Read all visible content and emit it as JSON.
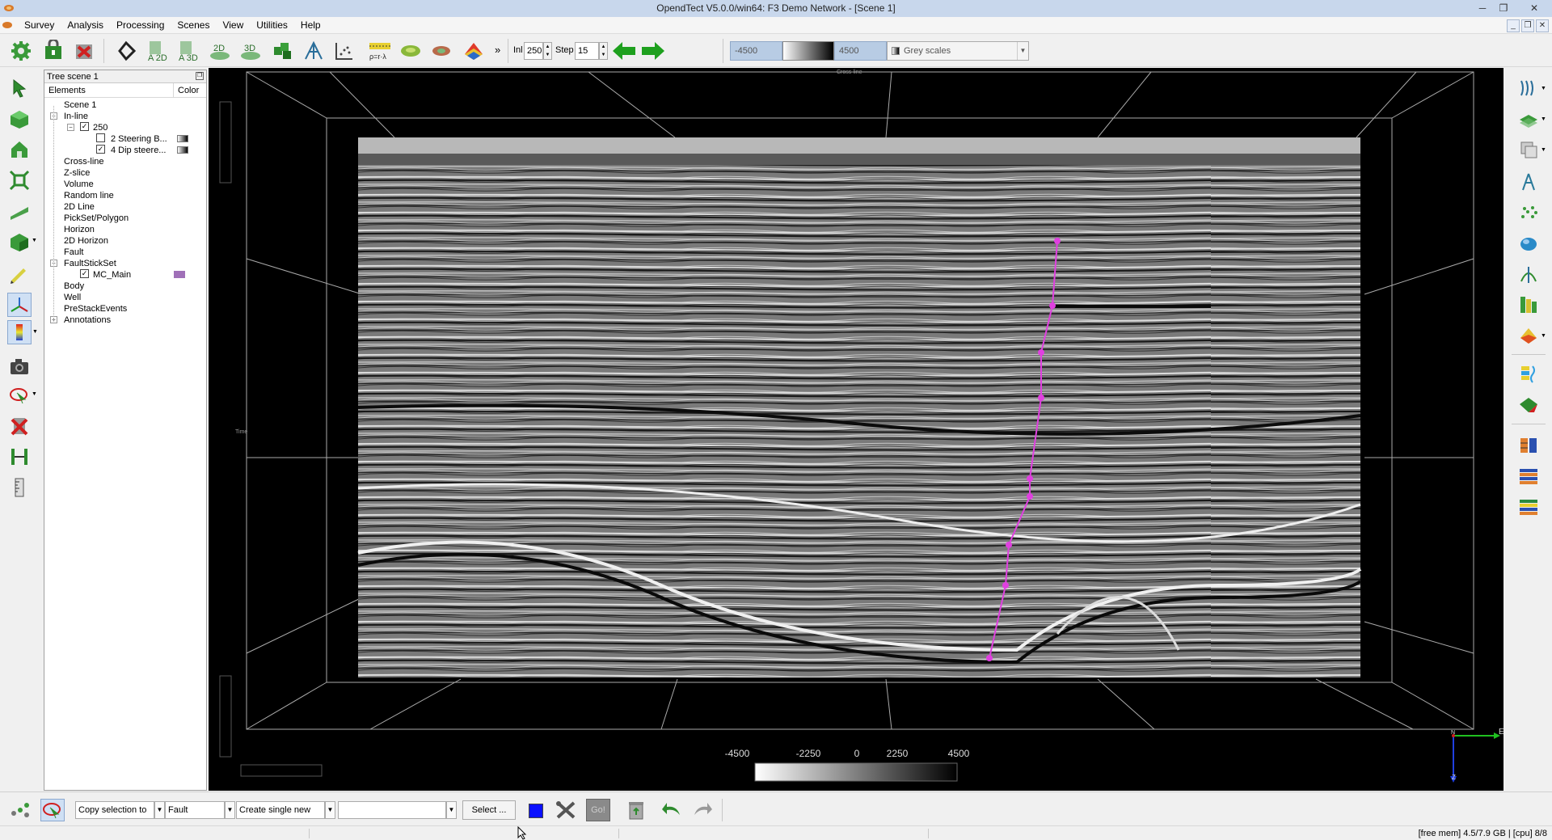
{
  "window": {
    "title": "OpendTect V5.0.0/win64: F3 Demo Network - [Scene 1]",
    "minimize": "─",
    "restore": "❐",
    "close": "✕"
  },
  "menu": {
    "items": [
      "Survey",
      "Analysis",
      "Processing",
      "Scenes",
      "View",
      "Utilities",
      "Help"
    ],
    "mdi_min": "_",
    "mdi_restore": "❐",
    "mdi_close": "✕"
  },
  "toolbar": {
    "more": "»",
    "inl_label": "Inl",
    "inl_value": "250",
    "step_label": "Step",
    "step_value": "15",
    "color_min": "-4500",
    "color_max": "4500",
    "colortable": "Grey scales"
  },
  "tree": {
    "panel_title": "Tree scene 1",
    "col_elements": "Elements",
    "col_color": "Color",
    "items": {
      "scene": "Scene 1",
      "inline": "In-line",
      "inline_250": "250",
      "steering": "2 Steering B...",
      "dipsteered": "4 Dip steere...",
      "crossline": "Cross-line",
      "zslice": "Z-slice",
      "volume": "Volume",
      "randomline": "Random line",
      "line2d": "2D Line",
      "pickset": "PickSet/Polygon",
      "horizon": "Horizon",
      "horizon2d": "2D Horizon",
      "fault": "Fault",
      "faultstickset": "FaultStickSet",
      "mc_main": "MC_Main",
      "body": "Body",
      "well": "Well",
      "prestack": "PreStackEvents",
      "annotations": "Annotations"
    },
    "faultstick_color": "#a070b8"
  },
  "scene": {
    "colorbar_ticks": [
      "-4500",
      "-2250",
      "0",
      "2250",
      "4500"
    ],
    "axis_crossline": "Cross-line",
    "axis_time": "Time",
    "compass_e": "E",
    "compass_n": "N",
    "compass_z": "Z",
    "fault_color": "#e040e0"
  },
  "bottom": {
    "copy_selection": "Copy selection to",
    "target_type": "Fault",
    "create_mode": "Create single new",
    "target_name": "",
    "select_button": "Select ...",
    "go_button": "Go!"
  },
  "status": {
    "memory": "[free mem] 4.5/7.9 GB | [cpu] 8/8"
  }
}
